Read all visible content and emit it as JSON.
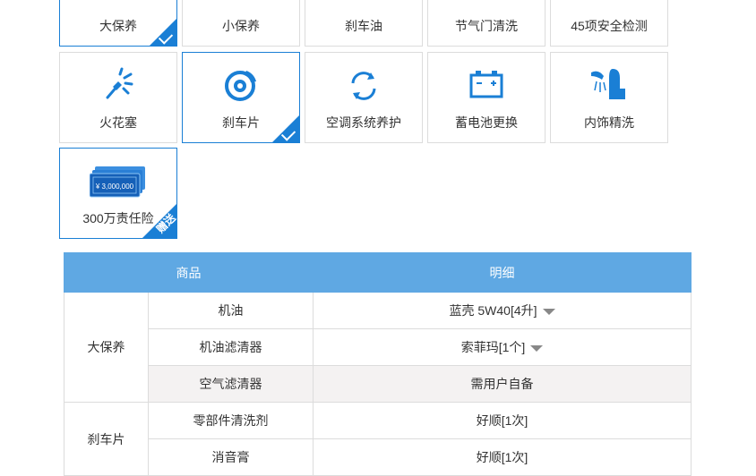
{
  "services": [
    {
      "label": "大保养",
      "icon": "oil-can-icon",
      "selected": true
    },
    {
      "label": "小保养",
      "icon": "filter-icon",
      "selected": false
    },
    {
      "label": "刹车油",
      "icon": "brake-fluid-icon",
      "selected": false
    },
    {
      "label": "节气门清洗",
      "icon": "throttle-icon",
      "selected": false
    },
    {
      "label": "45项安全检测",
      "icon": "safety-check-icon",
      "selected": false
    },
    {
      "label": "火花塞",
      "icon": "spark-plug-icon",
      "selected": false
    },
    {
      "label": "刹车片",
      "icon": "brake-disc-icon",
      "selected": true
    },
    {
      "label": "空调系统养护",
      "icon": "ac-cycle-icon",
      "selected": false
    },
    {
      "label": "蓄电池更换",
      "icon": "battery-icon",
      "selected": false
    },
    {
      "label": "内饰精洗",
      "icon": "seat-wash-icon",
      "selected": false
    },
    {
      "label": "300万责任险",
      "icon": "banknote-icon",
      "selected": false,
      "badge": "赠送",
      "note": "¥ 3,000,000"
    }
  ],
  "table": {
    "headers": {
      "product": "商品",
      "detail": "明细"
    },
    "groups": [
      {
        "name": "大保养",
        "rows": [
          {
            "item": "机油",
            "detail": "蓝壳 5W40[4升]",
            "dropdown": true
          },
          {
            "item": "机油滤清器",
            "detail": "索菲玛[1个]",
            "dropdown": true
          },
          {
            "item": "空气滤清器",
            "detail": "需用户自备",
            "dropdown": false
          }
        ]
      },
      {
        "name": "刹车片",
        "rows": [
          {
            "item": "零部件清洗剂",
            "detail": "好顺[1次]",
            "dropdown": false
          },
          {
            "item": "消音膏",
            "detail": "好顺[1次]",
            "dropdown": false
          }
        ]
      }
    ]
  },
  "colors": {
    "accent": "#1a7fd5",
    "header": "#5fa8e3",
    "border": "#dcdcdc"
  }
}
